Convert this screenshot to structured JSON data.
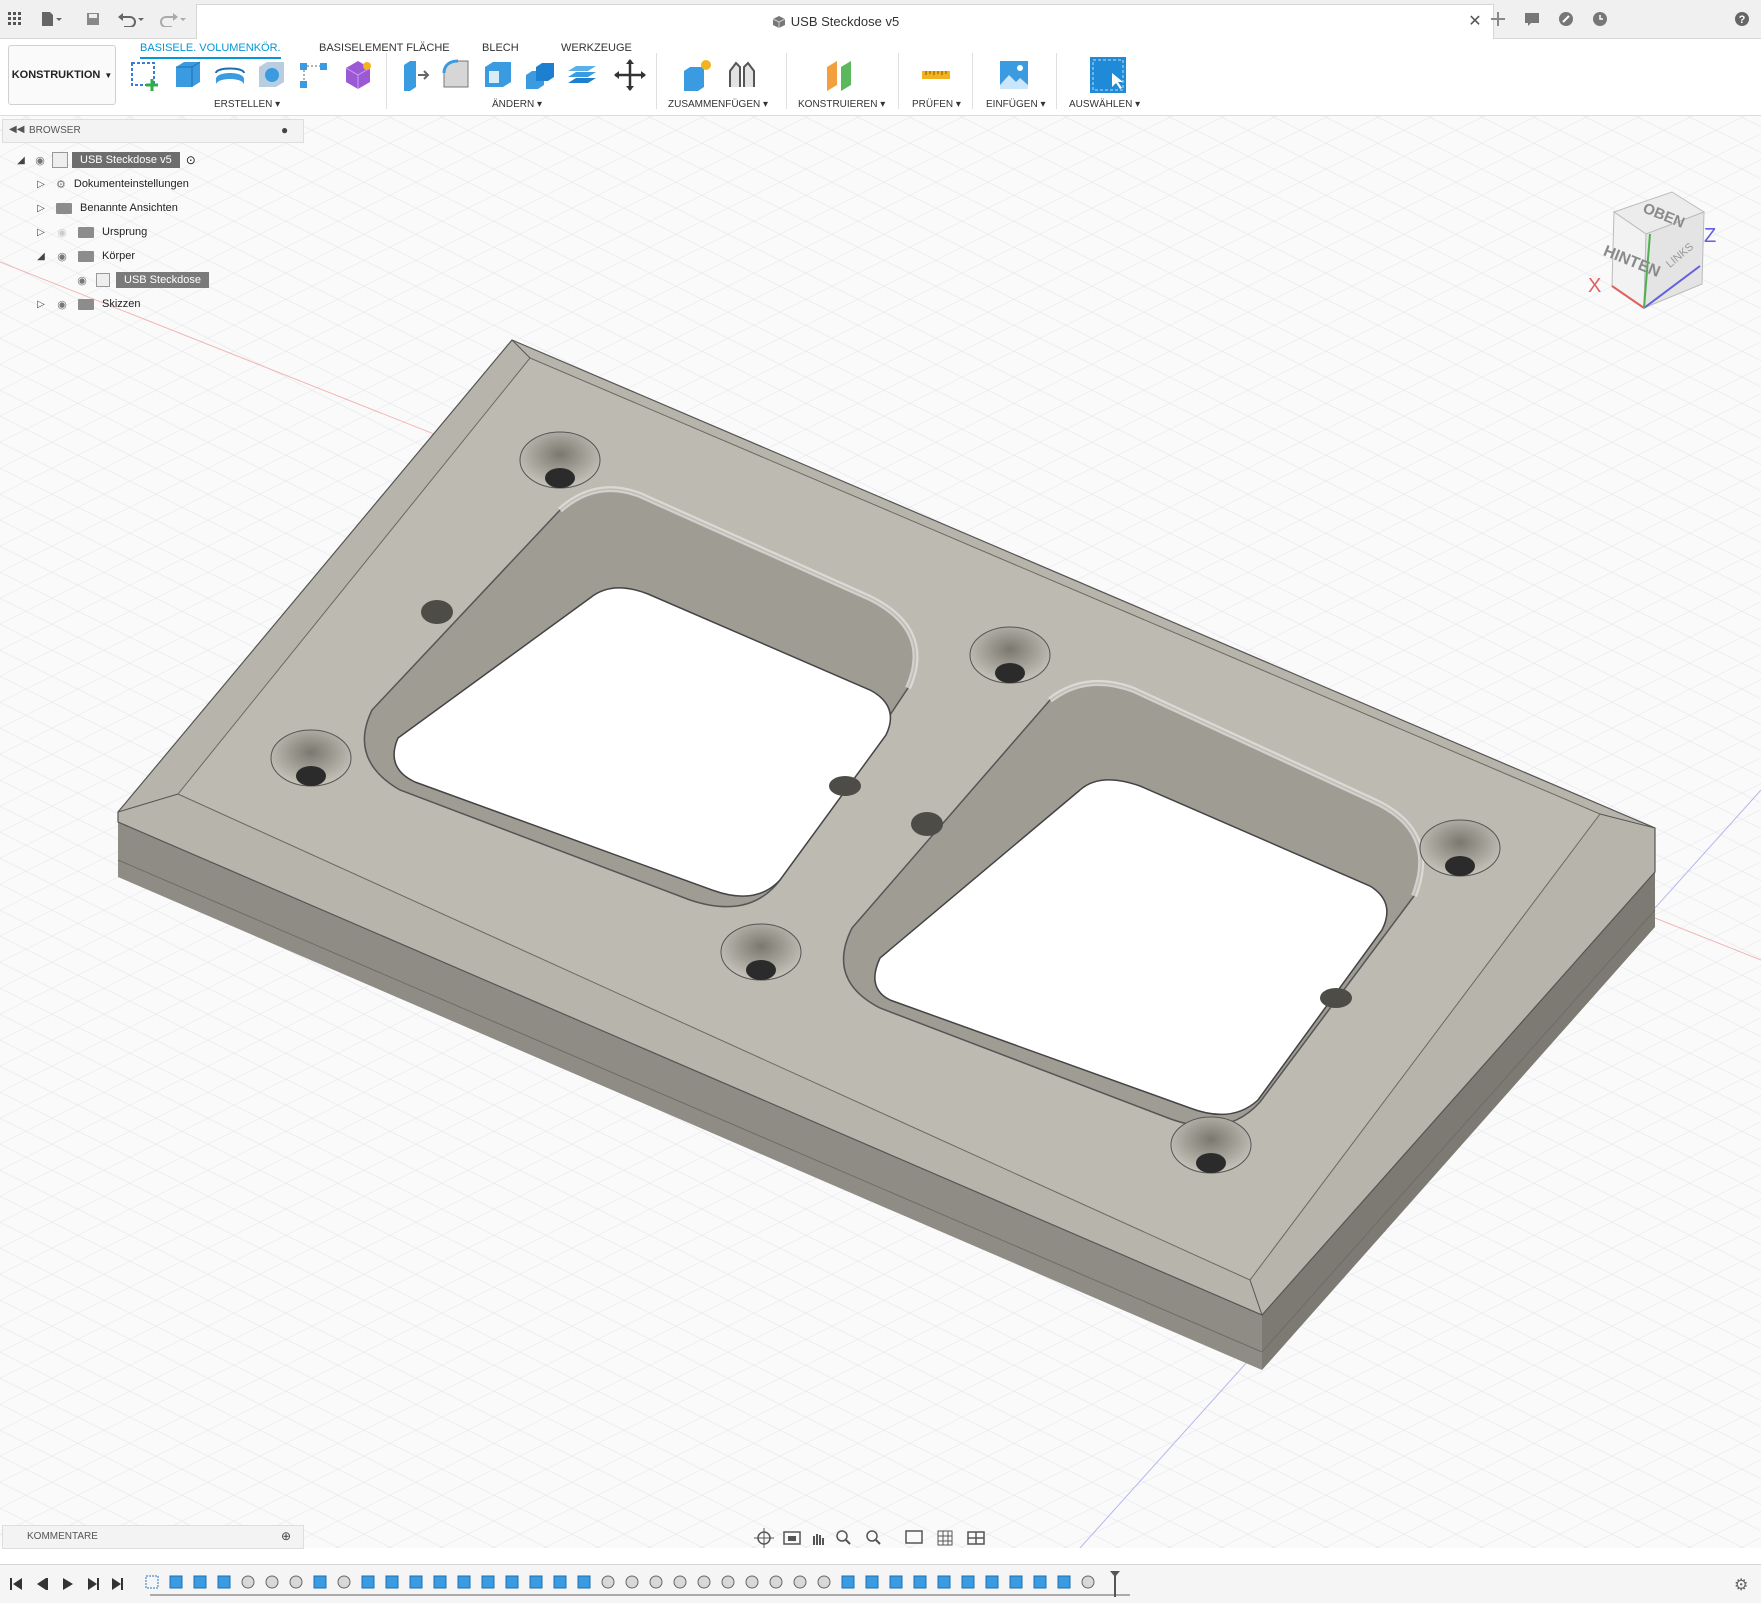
{
  "titlebar": {
    "document_title": "USB Steckdose v5"
  },
  "toolbar": {
    "workspace_label": "KONSTRUKTION",
    "tabs": [
      "BASISELE. VOLUMENKÖR.",
      "BASISELEMENT FLÄCHE",
      "BLECH",
      "WERKZEUGE"
    ],
    "groups": [
      "ERSTELLEN",
      "ÄNDERN",
      "ZUSAMMENFÜGEN",
      "KONSTRUIEREN",
      "PRÜFEN",
      "EINFÜGEN",
      "AUSWÄHLEN"
    ]
  },
  "browser": {
    "header": "BROWSER",
    "root": "USB Steckdose v5",
    "items": [
      "Dokumenteinstellungen",
      "Benannte Ansichten",
      "Ursprung",
      "Körper",
      "USB Steckdose",
      "Skizzen"
    ]
  },
  "viewcube": {
    "top": "OBEN",
    "back": "HINTEN",
    "left": "LINKS",
    "axis_x": "X",
    "axis_z": "Z"
  },
  "comments": {
    "label": "KOMMENTARE"
  },
  "colors": {
    "accent": "#0696d7",
    "body_top": "#bcb9b0",
    "body_side": "#8d8a83",
    "grid": "#dde3e8"
  }
}
